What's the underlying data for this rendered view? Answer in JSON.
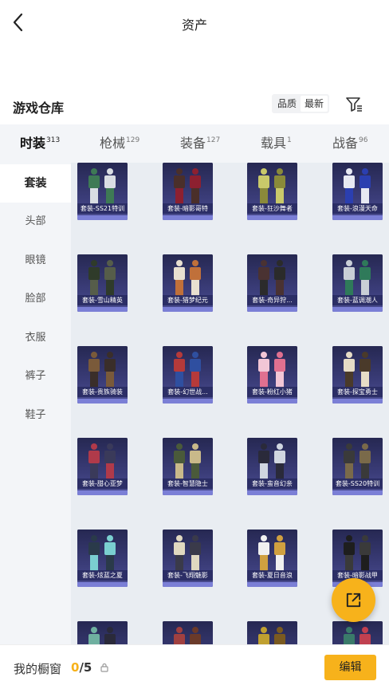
{
  "header": {
    "title": "资产"
  },
  "warehouse": {
    "title": "游戏仓库",
    "sort_options": [
      "品质",
      "最新"
    ],
    "active_sort": "最新"
  },
  "categories": [
    {
      "label": "时装",
      "count": "313",
      "active": true
    },
    {
      "label": "枪械",
      "count": "129",
      "active": false
    },
    {
      "label": "装备",
      "count": "127",
      "active": false
    },
    {
      "label": "载具",
      "count": "1",
      "active": false
    },
    {
      "label": "战备",
      "count": "96",
      "active": false
    }
  ],
  "subcategories": [
    {
      "label": "套装",
      "active": true
    },
    {
      "label": "头部",
      "active": false
    },
    {
      "label": "眼镜",
      "active": false
    },
    {
      "label": "脸部",
      "active": false
    },
    {
      "label": "衣服",
      "active": false
    },
    {
      "label": "裤子",
      "active": false
    },
    {
      "label": "鞋子",
      "active": false
    }
  ],
  "items": [
    {
      "name": "套装-SS21特训"
    },
    {
      "name": "套装-暗影哥特"
    },
    {
      "name": "套装-狂沙舞者"
    },
    {
      "name": "套装-浪漫天命"
    },
    {
      "name": "套装-雪山精英"
    },
    {
      "name": "套装-猎梦纪元"
    },
    {
      "name": "套装-奇异狩..."
    },
    {
      "name": "套装-蓝调潮人"
    },
    {
      "name": "套装-贵族骑装"
    },
    {
      "name": "套装-幻世战..."
    },
    {
      "name": "套装-粉红小猪"
    },
    {
      "name": "套装-探宝勇士"
    },
    {
      "name": "套装-甜心亚梦"
    },
    {
      "name": "套装-智慧隐士"
    },
    {
      "name": "套装-蛮音幻亲"
    },
    {
      "name": "套装-SS20特训"
    },
    {
      "name": "套装-炫蓝之夏"
    },
    {
      "name": "套装-飞翔魅影"
    },
    {
      "name": "套装-夏日音浪"
    },
    {
      "name": "套装-暗影战甲"
    },
    {
      "name": ""
    },
    {
      "name": ""
    },
    {
      "name": ""
    },
    {
      "name": ""
    }
  ],
  "item_palettes": [
    [
      "#3e7a55",
      "#d9dde3"
    ],
    [
      "#4a2f2a",
      "#8d2030"
    ],
    [
      "#c9c96a",
      "#8a8a3a"
    ],
    [
      "#e7e9f2",
      "#2b3fb0"
    ],
    [
      "#2f3b2a",
      "#565d4a"
    ],
    [
      "#e8dfd0",
      "#c0703a"
    ],
    [
      "#4a3232",
      "#2b2b2b"
    ],
    [
      "#c9ced6",
      "#2f7a5a"
    ],
    [
      "#7a5a3a",
      "#3a2e2a"
    ],
    [
      "#b63a3a",
      "#2f4fa0"
    ],
    [
      "#f2c6d6",
      "#e07090"
    ],
    [
      "#e6dcc6",
      "#4a3a2a"
    ],
    [
      "#b03a4a",
      "#3a3a5a"
    ],
    [
      "#4a5a3a",
      "#c9b98a"
    ],
    [
      "#2a2a3a",
      "#d0d6e0"
    ],
    [
      "#3a3a3a",
      "#7a6a4a"
    ],
    [
      "#2a3a4a",
      "#7acfd0"
    ],
    [
      "#e0d8c0",
      "#3a3a4a"
    ],
    [
      "#f0f0f0",
      "#d0a040"
    ],
    [
      "#1e1e1e",
      "#3a3a3a"
    ],
    [
      "#6fb0a0",
      "#2a2a3a"
    ],
    [
      "#a04040",
      "#6a3a2a"
    ],
    [
      "#c0a030",
      "#7a5a20"
    ],
    [
      "#3a7a6a",
      "#c04050"
    ]
  ],
  "showcase": {
    "label": "我的橱窗",
    "current": "0",
    "total": "/5"
  },
  "edit_label": "编辑",
  "colors": {
    "accent": "#f7b21b",
    "card_bg": "#2a2b57",
    "grid_bg": "#e9edf2",
    "tab_bg": "#f3f5f8"
  },
  "icons": [
    "back-arrow-icon",
    "filter-icon",
    "lock-icon",
    "share-external-icon"
  ]
}
